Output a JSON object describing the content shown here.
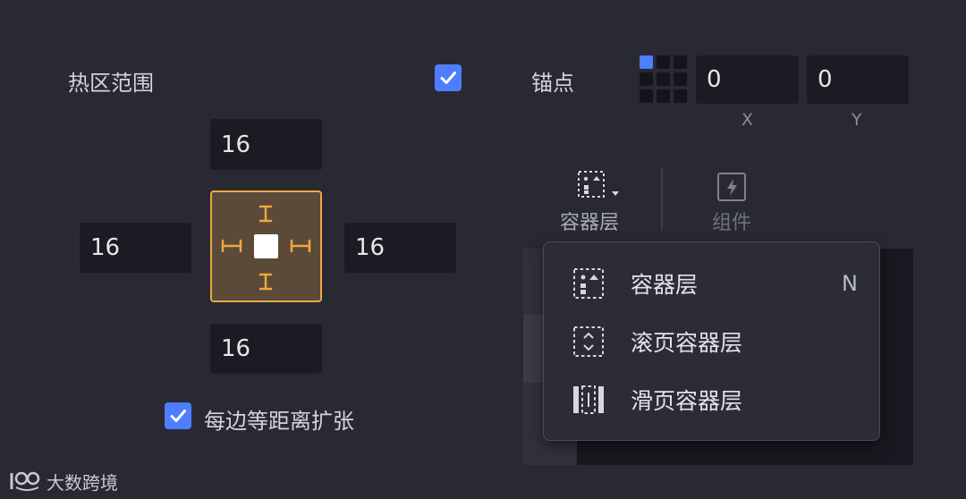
{
  "hotzone": {
    "label": "热区范围",
    "enabled": true,
    "top": "16",
    "left": "16",
    "right": "16",
    "bottom": "16",
    "equal_expand_label": "每边等距离扩张",
    "equal_expand_checked": true
  },
  "anchor": {
    "label": "锚点",
    "x_value": "0",
    "y_value": "0",
    "x_label": "X",
    "y_label": "Y"
  },
  "toolbar": {
    "container_layer_label": "容器层",
    "component_label": "组件"
  },
  "layer_menu": {
    "items": [
      {
        "label": "容器层",
        "shortcut": "N",
        "icon": "container-layer-icon"
      },
      {
        "label": "滚页容器层",
        "shortcut": "",
        "icon": "scroll-container-icon"
      },
      {
        "label": "滑页容器层",
        "shortcut": "",
        "icon": "slide-container-icon"
      }
    ]
  },
  "watermark": {
    "text": "大数跨境"
  },
  "colors": {
    "background": "#282933",
    "field": "#1b1c23",
    "accent_blue": "#4f7dff",
    "hotzone_orange": "#f0a640",
    "hotzone_fill": "#5b4a37"
  }
}
